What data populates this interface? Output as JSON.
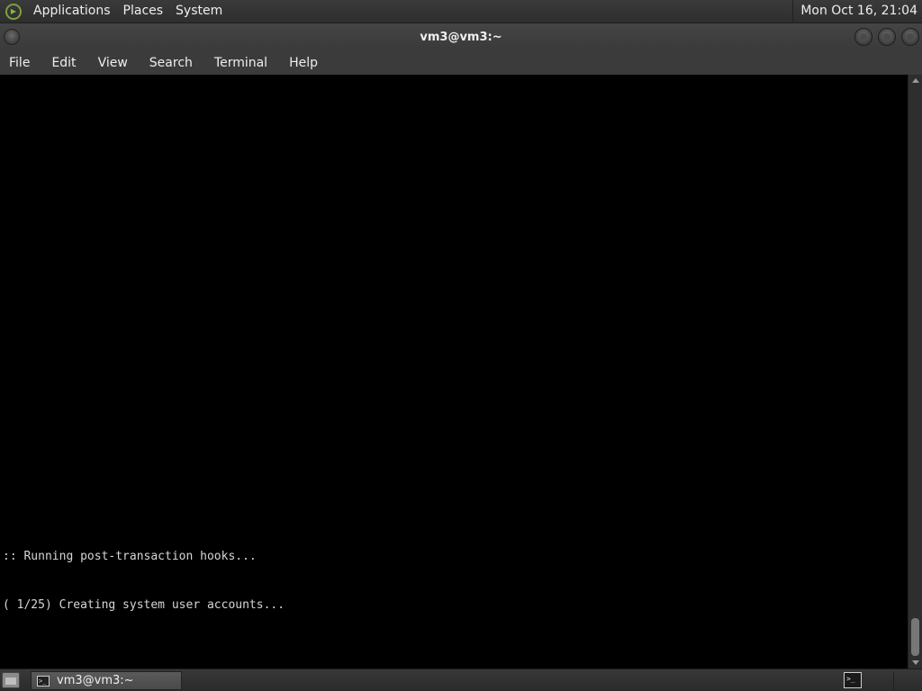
{
  "top_panel": {
    "menus": [
      "Applications",
      "Places",
      "System"
    ],
    "clock": "Mon Oct 16, 21:04"
  },
  "window": {
    "title": "vm3@vm3:~"
  },
  "menubar": {
    "items": [
      "File",
      "Edit",
      "View",
      "Search",
      "Terminal",
      "Help"
    ]
  },
  "terminal": {
    "lines": [
      ":: Running post-transaction hooks...",
      "( 1/25) Creating system user accounts..."
    ]
  },
  "taskbar": {
    "task_label": "vm3@vm3:~"
  },
  "icons": {
    "app_logo": "app-logo-icon",
    "terminal": "terminal-icon",
    "show_desktop": "show-desktop-icon"
  }
}
